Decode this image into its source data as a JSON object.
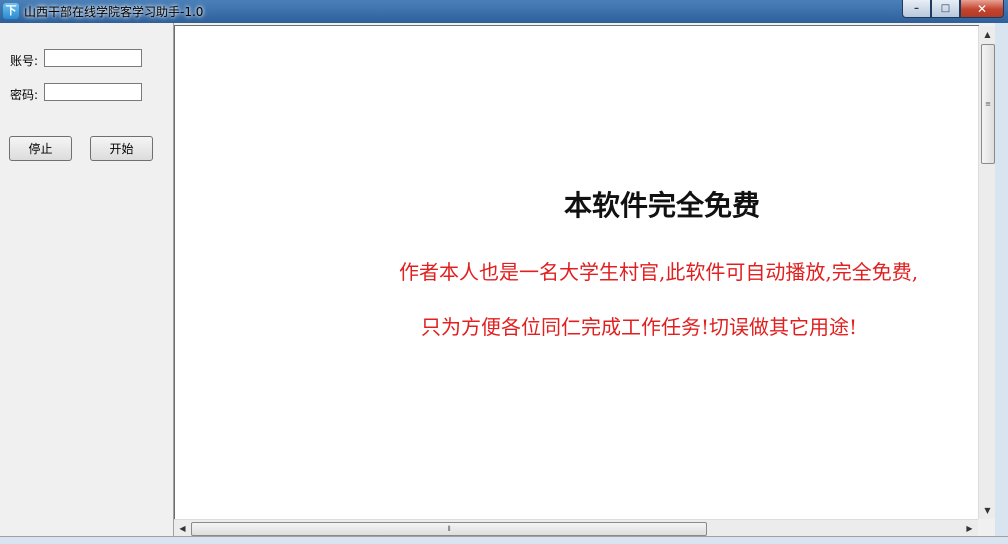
{
  "window": {
    "title": "山西干部在线学院客学习助手-1.0",
    "app_icon_glyph": "下",
    "controls": {
      "minimize": "–",
      "maximize": "□",
      "close": "✕"
    }
  },
  "login": {
    "account_label": "账号:",
    "account_value": "",
    "password_label": "密码:",
    "password_value": ""
  },
  "buttons": {
    "stop": "停止",
    "start": "开始"
  },
  "content": {
    "headline": "本软件完全免费",
    "line1": "作者本人也是一名大学生村官,此软件可自动播放,完全免费,",
    "line2": "只为方便各位同仁完成工作任务!切误做其它用途!"
  },
  "scroll": {
    "up": "▲",
    "down": "▼",
    "left": "◀",
    "right": "▶",
    "v_grip": "≡",
    "h_grip": "⦀"
  },
  "colors": {
    "titlebar": "#3f74ae",
    "notice_red": "#e02020",
    "headline": "#111111"
  }
}
